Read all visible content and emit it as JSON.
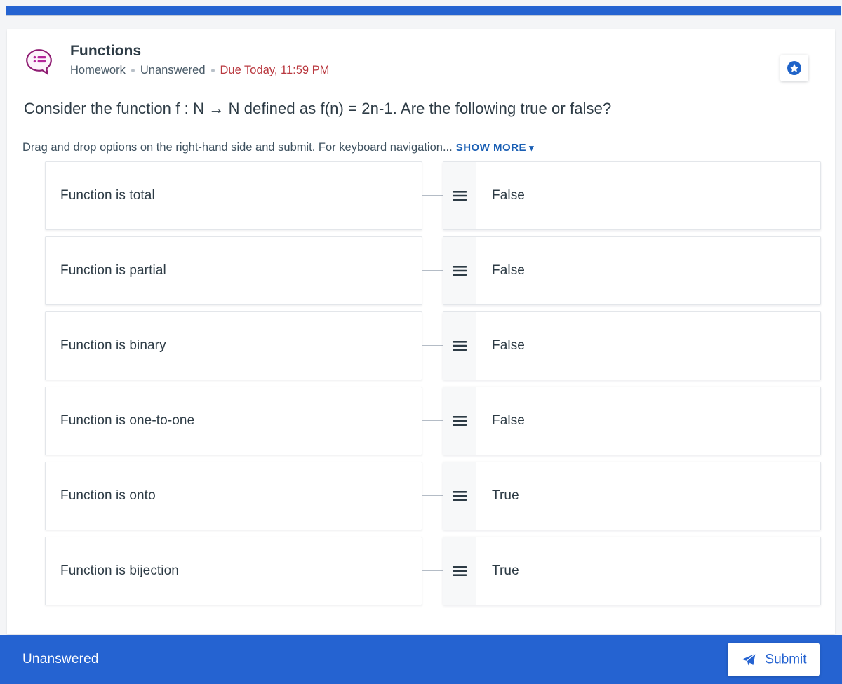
{
  "top_bar": {
    "color": "#2563d1"
  },
  "header": {
    "icon": "speech-bubble-list-icon",
    "title": "Functions",
    "type_label": "Homework",
    "status_label": "Unanswered",
    "due_label": "Due Today, 11:59 PM",
    "due_color": "#b9383f",
    "star_icon": "star-circle-icon"
  },
  "question": {
    "text": "Consider the function f : N → N defined as f(n) = 2n-1. Are the following true or false?",
    "instructions": "Drag and drop options on the right-hand side and submit. For keyboard navigation...",
    "show_more_label": "SHOW MORE",
    "chevron_icon": "chevron-down-icon",
    "link_color": "#1a5fb4"
  },
  "matching": {
    "handle_icon": "drag-handle-icon",
    "rows": [
      {
        "prompt": "Function is total",
        "answer": "False"
      },
      {
        "prompt": "Function is partial",
        "answer": "False"
      },
      {
        "prompt": "Function is binary",
        "answer": "False"
      },
      {
        "prompt": "Function is one-to-one",
        "answer": "False"
      },
      {
        "prompt": "Function is onto",
        "answer": "True"
      },
      {
        "prompt": "Function is bijection",
        "answer": "True"
      }
    ]
  },
  "footer": {
    "status": "Unanswered",
    "submit_label": "Submit",
    "submit_icon": "paper-plane-icon",
    "bar_color": "#2563d1"
  }
}
